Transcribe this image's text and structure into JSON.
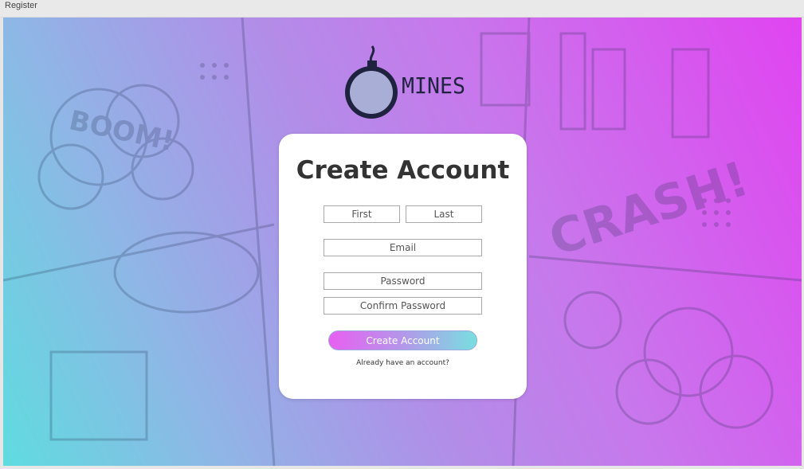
{
  "window": {
    "title": "Register"
  },
  "logo": {
    "text": "MINES",
    "icon": "bomb-icon"
  },
  "background": {
    "words": [
      "BOOM!",
      "CRASH!"
    ]
  },
  "form": {
    "heading": "Create Account",
    "first_placeholder": "First",
    "last_placeholder": "Last",
    "email_placeholder": "Email",
    "password_placeholder": "Password",
    "confirm_placeholder": "Confirm Password",
    "submit_label": "Create Account",
    "login_link": "Already have an account?"
  },
  "colors": {
    "gradient_left": "#5fdcdf",
    "gradient_right": "#e044f0",
    "button_left": "#e85ff0",
    "button_right": "#78dfe0"
  }
}
